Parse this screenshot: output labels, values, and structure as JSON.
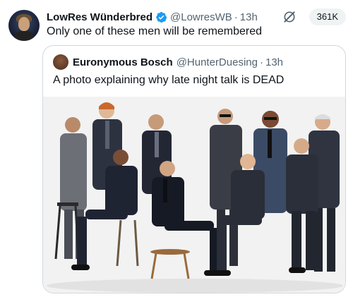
{
  "tweet": {
    "author": {
      "display_name": "LowRes Wünderbred",
      "handle": "@LowresWB",
      "verified": true
    },
    "separator": "·",
    "time": "13h",
    "text": "Only one of these men will be remembered",
    "views": "361K"
  },
  "quoted_tweet": {
    "author": {
      "display_name": "Euronymous Bosch",
      "handle": "@HunterDuesing"
    },
    "separator": "·",
    "time": "13h",
    "text": "A photo explaining why late night talk is DEAD",
    "image_subject": "group portrait of ten men in suits posed on stools against a white background"
  },
  "colors": {
    "verified": "#1d9bf0",
    "muted_text": "#536471",
    "border": "#cfd9de"
  }
}
